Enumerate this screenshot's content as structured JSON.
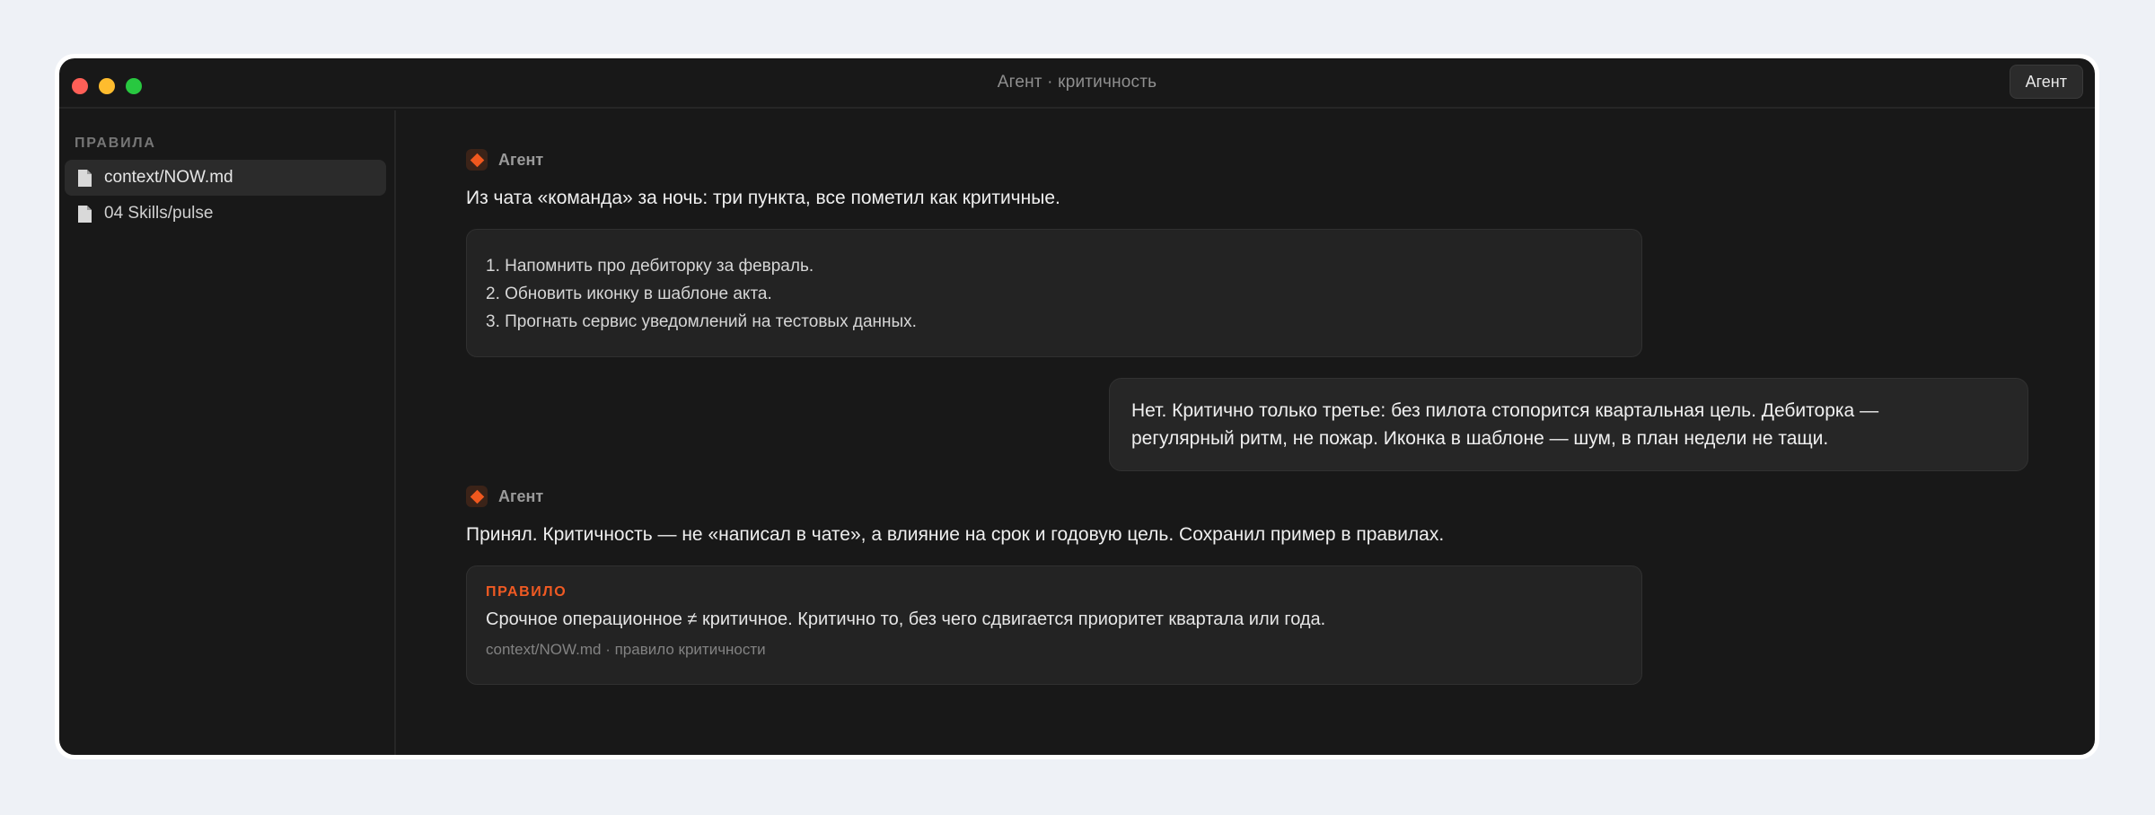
{
  "window": {
    "title": "Агент · критичность",
    "agent_button": "Агент"
  },
  "sidebar": {
    "heading": "ПРАВИЛА",
    "items": [
      {
        "label": "context/NOW.md",
        "active": true
      },
      {
        "label": "04 Skills/pulse",
        "active": false
      }
    ]
  },
  "chat": {
    "messages": [
      {
        "author": "Агент",
        "text": "Из чата «команда» за ночь: три пункта, все пометил как критичные.",
        "list": [
          "1. Напомнить про дебиторку за февраль.",
          "2. Обновить иконку в шаблоне акта.",
          "3. Прогнать сервис уведомлений на тестовых данных."
        ]
      },
      {
        "author": "user",
        "lines": [
          "Нет. Критично только третье: без пилота стопорится квартальная цель. Дебиторка —",
          "регулярный ритм, не пожар. Иконка в шаблоне — шум, в план недели не тащи."
        ]
      },
      {
        "author": "Агент",
        "text": "Принял. Критичность — не «написал в чате», а влияние на срок и годовую цель. Сохранил пример в правилах.",
        "rule": {
          "tag": "ПРАВИЛО",
          "text": "Срочное операционное ≠ критичное. Критично то, без чего сдвигается приоритет квартала или года.",
          "source": "context/NOW.md · правило критичности"
        }
      }
    ]
  },
  "colors": {
    "accent": "#f05a23",
    "window_bg": "#181818",
    "page_bg": "#eef1f6"
  },
  "icons": {
    "file": "file-icon",
    "agent": "agent-diamond-icon"
  }
}
